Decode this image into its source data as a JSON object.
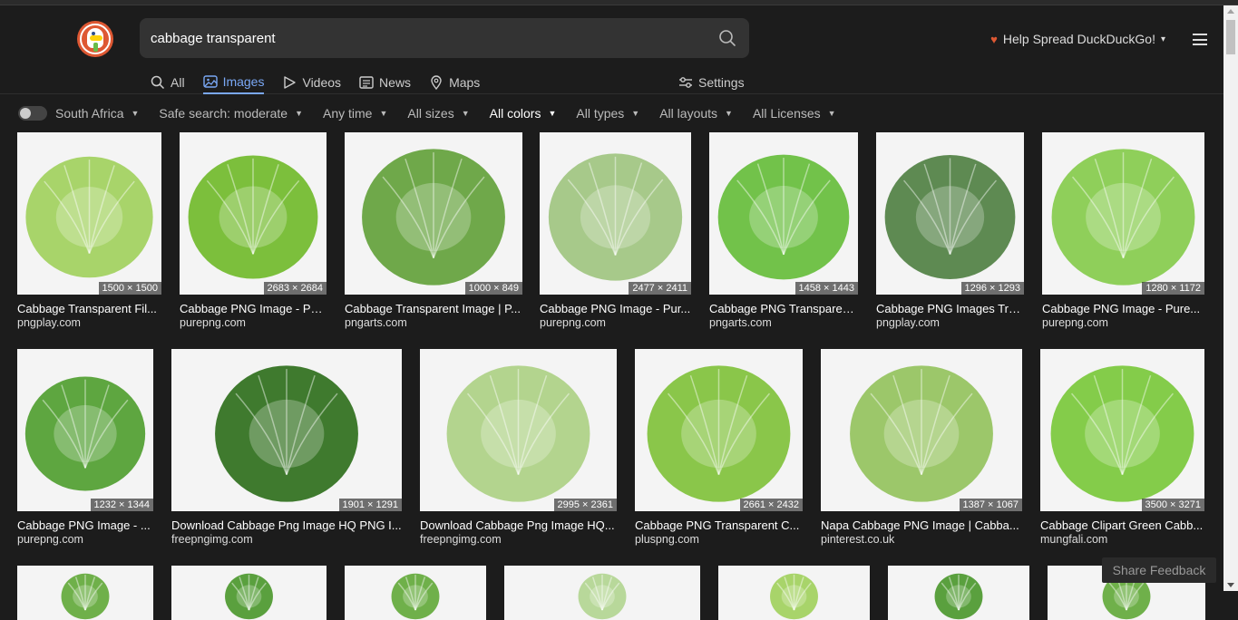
{
  "search": {
    "query": "cabbage transparent"
  },
  "tabs": [
    {
      "label": "All",
      "icon": "search-icon"
    },
    {
      "label": "Images",
      "icon": "image-icon"
    },
    {
      "label": "Videos",
      "icon": "play-icon"
    },
    {
      "label": "News",
      "icon": "news-icon"
    },
    {
      "label": "Maps",
      "icon": "map-pin-icon"
    }
  ],
  "settings_label": "Settings",
  "help_label": "Help Spread DuckDuckGo!",
  "filters": {
    "region": "South Africa",
    "safe_search": "Safe search: moderate",
    "time": "Any time",
    "sizes": "All sizes",
    "colors": "All colors",
    "types": "All types",
    "layouts": "All layouts",
    "licenses": "All Licenses"
  },
  "results_row1": [
    {
      "title": "Cabbage Transparent Fil...",
      "source": "pngplay.com",
      "dims": "1500 × 1500",
      "color": "#a8d46a"
    },
    {
      "title": "Cabbage PNG Image - Pu...",
      "source": "purepng.com",
      "dims": "2683 × 2684",
      "color": "#7cbf3c"
    },
    {
      "title": "Cabbage Transparent Image | P...",
      "source": "pngarts.com",
      "dims": "1000 × 849",
      "color": "#6fa84a"
    },
    {
      "title": "Cabbage PNG Image - Pur...",
      "source": "purepng.com",
      "dims": "2477 × 2411",
      "color": "#a7c98a"
    },
    {
      "title": "Cabbage PNG Transparen...",
      "source": "pngarts.com",
      "dims": "1458 × 1443",
      "color": "#72c24a"
    },
    {
      "title": "Cabbage PNG Images Tra...",
      "source": "pngplay.com",
      "dims": "1296 × 1293",
      "color": "#5e8a52"
    },
    {
      "title": "Cabbage PNG Image - Pure...",
      "source": "purepng.com",
      "dims": "1280 × 1172",
      "color": "#8fcf5a"
    }
  ],
  "results_row2": [
    {
      "title": "Cabbage PNG Image - ...",
      "source": "purepng.com",
      "dims": "1232 × 1344",
      "color": "#5ea640"
    },
    {
      "title": "Download Cabbage Png Image HQ PNG I...",
      "source": "freepngimg.com",
      "dims": "1901 × 1291",
      "color": "#3f7a2e"
    },
    {
      "title": "Download Cabbage Png Image HQ...",
      "source": "freepngimg.com",
      "dims": "2995 × 2361",
      "color": "#b3d48e"
    },
    {
      "title": "Cabbage PNG Transparent C...",
      "source": "pluspng.com",
      "dims": "2661 × 2432",
      "color": "#8ac64a"
    },
    {
      "title": "Napa Cabbage PNG Image | Cabba...",
      "source": "pinterest.co.uk",
      "dims": "1387 × 1067",
      "color": "#9cc76a"
    },
    {
      "title": "Cabbage Clipart Green Cabb...",
      "source": "mungfali.com",
      "dims": "3500 × 3271",
      "color": "#84cc4a"
    }
  ],
  "row3_colors": [
    "#6fb04a",
    "#5aa03e",
    "#6fb04a",
    "#b8d89a",
    "#a8d46a",
    "#5aa03e",
    "#6fb04a"
  ],
  "feedback_label": "Share Feedback"
}
